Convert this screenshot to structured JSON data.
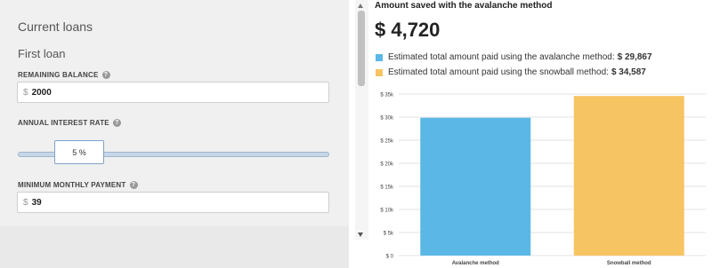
{
  "loans": {
    "section_title": "Current loans",
    "loan_title": "First loan",
    "remaining_balance": {
      "label": "REMAINING BALANCE",
      "prefix": "$",
      "value": "2000"
    },
    "interest_rate": {
      "label": "ANNUAL INTEREST RATE",
      "value": "5 %"
    },
    "min_payment": {
      "label": "MINIMUM MONTHLY PAYMENT",
      "prefix": "$",
      "value": "39"
    },
    "help_glyph": "?"
  },
  "summary": {
    "title": "Amount saved with the avalanche method",
    "amount": "$ 4,720",
    "legend": [
      {
        "text": "Estimated total amount paid using the avalanche method:",
        "value": "$ 29,867",
        "color": "#5bb8e6"
      },
      {
        "text": "Estimated total amount paid using the snowball method:",
        "value": "$ 34,587",
        "color": "#f7c463"
      }
    ]
  },
  "chart_data": {
    "type": "bar",
    "categories": [
      "Avalanche method",
      "Snowball method"
    ],
    "values": [
      29867,
      34587
    ],
    "colors": [
      "#5bb8e6",
      "#f7c463"
    ],
    "ylim": [
      0,
      35000
    ],
    "yticks": [
      "$ 0",
      "$ 5k",
      "$ 10k",
      "$ 15k",
      "$ 20k",
      "$ 25k",
      "$ 30k",
      "$ 35k"
    ],
    "grid": true
  }
}
